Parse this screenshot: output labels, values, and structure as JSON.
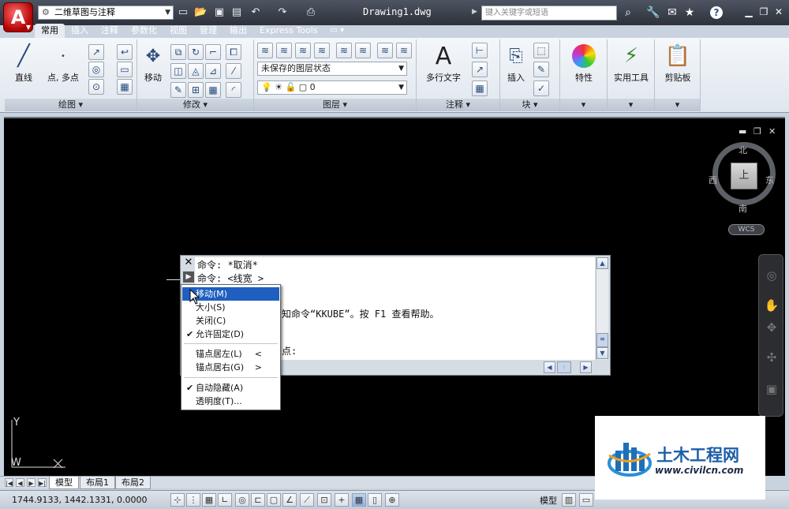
{
  "titlebar": {
    "workspace": "二维草图与注释",
    "document_title": "Drawing1.dwg",
    "search_placeholder": "键入关键字或短语"
  },
  "ribbon": {
    "tabs": [
      "常用",
      "插入",
      "注释",
      "参数化",
      "视图",
      "管理",
      "输出",
      "Express Tools"
    ],
    "active_tab": "常用",
    "panels": {
      "draw": {
        "title": "绘图",
        "line_label": "直线",
        "point_label": "点, 多点"
      },
      "modify": {
        "title": "修改",
        "move_label": "移动"
      },
      "layers": {
        "title": "图层",
        "layer_state": "未保存的图层状态",
        "current_layer": "0"
      },
      "annotation": {
        "title": "注释",
        "mtext_label": "多行文字"
      },
      "block": {
        "title": "块",
        "insert_label": "插入"
      },
      "properties": {
        "title": "特性"
      },
      "utilities": {
        "title": "实用工具"
      },
      "clipboard": {
        "title": "剪贴板"
      }
    }
  },
  "viewcube": {
    "north": "北",
    "south": "南",
    "east": "东",
    "west": "西",
    "face": "上",
    "wcs": "WCS"
  },
  "ucs": {
    "y_label": "Y",
    "w_label": "W"
  },
  "command_window": {
    "lines": [
      "命令: *取消*",
      "命令:  <线宽 >",
      "知命令“KKUBE”。按 F1 查看帮助。",
      "点:"
    ]
  },
  "context_menu": {
    "items": [
      {
        "label": "移动(M)",
        "checked": false,
        "highlighted": true
      },
      {
        "label": "大小(S)",
        "checked": false
      },
      {
        "label": "关闭(C)",
        "checked": false
      },
      {
        "label": "允许固定(D)",
        "checked": true
      },
      {
        "label": "锚点居左(L)",
        "checked": false,
        "submenu": "<"
      },
      {
        "label": "锚点居右(G)",
        "checked": false,
        "submenu": ">"
      },
      {
        "label": "自动隐藏(A)",
        "checked": true
      },
      {
        "label": "透明度(T)...",
        "checked": false
      }
    ]
  },
  "layout_tabs": [
    "模型",
    "布局1",
    "布局2"
  ],
  "status": {
    "coordinates": "1744.9133, 1442.1331, 0.0000",
    "space": "模型"
  },
  "watermark": {
    "name": "土木工程网",
    "url": "www.civilcn.com"
  }
}
